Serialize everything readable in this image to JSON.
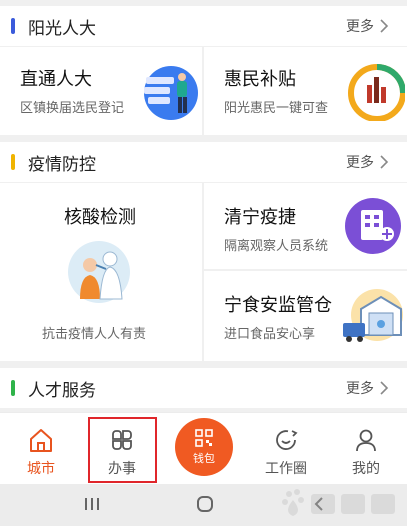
{
  "sections": [
    {
      "title": "阳光人大",
      "more": "更多",
      "accent": "#3b5bdb"
    },
    {
      "title": "疫情防控",
      "more": "更多",
      "accent": "#f0b400"
    },
    {
      "title": "人才服务",
      "more": "更多",
      "accent": "#2fb34a"
    }
  ],
  "cards": {
    "zhitong": {
      "title": "直通人大",
      "subtitle": "区镇换届选民登记"
    },
    "huimin": {
      "title": "惠民补贴",
      "subtitle": "阳光惠民一键可查"
    },
    "hesuan": {
      "title": "核酸检测",
      "subtitle": "抗击疫情人人有责"
    },
    "qingning": {
      "title": "清宁疫捷",
      "subtitle": "隔离观察人员系统"
    },
    "ningshi": {
      "title": "宁食安监管仓",
      "subtitle": "进口食品安心享"
    }
  },
  "tabbar": {
    "items": [
      {
        "label": "城市",
        "icon": "home-icon",
        "active": true
      },
      {
        "label": "办事",
        "icon": "clover-grid-icon",
        "active": false
      },
      {
        "label": "钱包",
        "icon": "wallet-qr-icon",
        "active": false
      },
      {
        "label": "工作圈",
        "icon": "chat-circle-icon",
        "active": false
      },
      {
        "label": "我的",
        "icon": "person-icon",
        "active": false
      }
    ]
  },
  "colors": {
    "active": "#e8541f",
    "wallet": "#f05a22",
    "highlight_box": "#e0262b"
  },
  "nav_icons": [
    "recents-icon",
    "home-circle-icon",
    "back-icon"
  ]
}
